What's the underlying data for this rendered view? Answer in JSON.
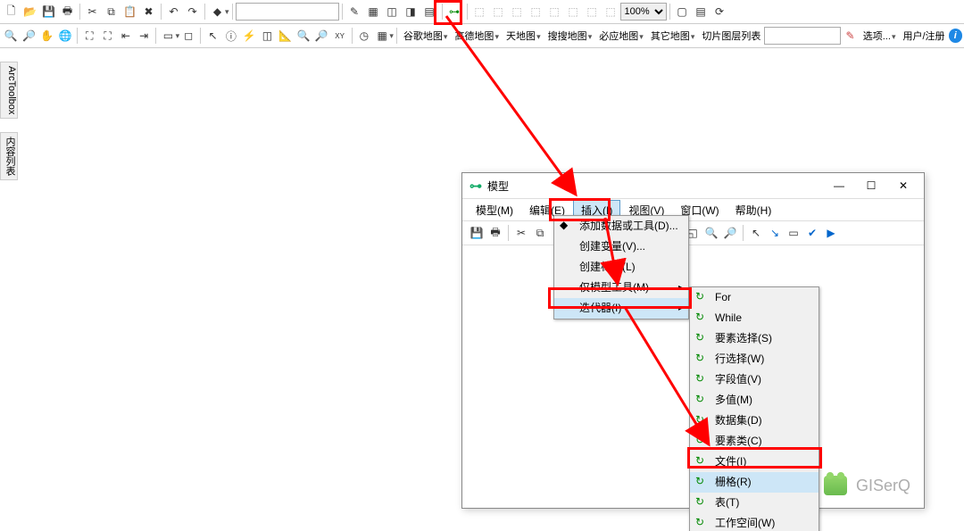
{
  "main_toolbar1": {
    "zoom_value": "100%"
  },
  "main_toolbar2": {
    "maps": [
      "谷歌地图",
      "高德地图",
      "天地图",
      "搜搜地图",
      "必应地图",
      "其它地图"
    ],
    "layer_list": "切片图层列表",
    "options": "选项...",
    "user_reg": "用户/注册"
  },
  "side_tabs": {
    "toolbox": "ArcToolbox",
    "content": "内容列表"
  },
  "dialog": {
    "title": "模型",
    "menu": {
      "model": "模型(M)",
      "edit": "编辑(E)",
      "insert": "插入(I)",
      "view": "视图(V)",
      "window": "窗口(W)",
      "help": "帮助(H)"
    },
    "window_buttons": {
      "min": "—",
      "max": "☐",
      "close": "✕"
    }
  },
  "insert_menu": {
    "add_data": "添加数据或工具(D)...",
    "create_var": "创建变量(V)...",
    "create_label": "创建标注(L)",
    "model_only": "仅模型工具(M)",
    "iterators": "迭代器(I)"
  },
  "iter_menu": {
    "for": "For",
    "while": "While",
    "feat_sel": "要素选择(S)",
    "row_sel": "行选择(W)",
    "field_val": "字段值(V)",
    "multi_val": "多值(M)",
    "dataset": "数据集(D)",
    "feat_class": "要素类(C)",
    "file": "文件(I)",
    "raster": "栅格(R)",
    "table": "表(T)",
    "workspace": "工作空间(W)"
  },
  "watermark": "GISerQ"
}
